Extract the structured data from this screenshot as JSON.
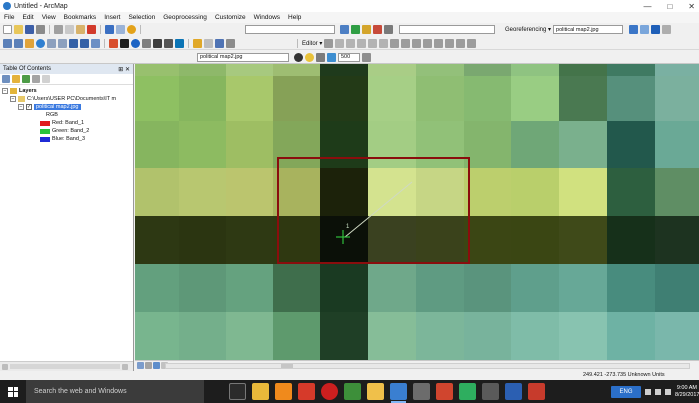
{
  "window": {
    "title": "Untitled - ArcMap",
    "minimize": "—",
    "maximize": "□",
    "close": "✕"
  },
  "menu": [
    "File",
    "Edit",
    "View",
    "Bookmarks",
    "Insert",
    "Selection",
    "Geoprocessing",
    "Customize",
    "Windows",
    "Help"
  ],
  "toolbar": {
    "georeferencing_label": "Georeferencing ▾",
    "georef_layer": "political map2.jpg",
    "editor_label": "Editor ▾",
    "layer_dropdown": "political map2.jpg",
    "value_box": "500"
  },
  "toc": {
    "title": "Table Of Contents",
    "pin": "⊞ ✕",
    "layers_label": "Layers",
    "folder_path": "C:\\Users\\USER PC\\Documents\\IT m",
    "layer_name": "political map2.jpg",
    "rgb_label": "RGB",
    "bands": [
      {
        "label": "Red:   Band_1",
        "color": "#e11b1b"
      },
      {
        "label": "Green: Band_2",
        "color": "#29c33b"
      },
      {
        "label": "Blue:  Band_3",
        "color": "#1f2bd6"
      }
    ]
  },
  "map": {
    "accent_frame_color": "#8a0d0d",
    "link_color": "#cfd9c3",
    "cursor_color": "#2fbf3b",
    "cursor_number": "1"
  },
  "status": {
    "coordinates": "249.421  -273.735 Unknown Units"
  },
  "taskbar": {
    "search_placeholder": "Search the web and Windows",
    "language": "ENG",
    "time": "9:00 AM",
    "date": "8/29/2017"
  }
}
